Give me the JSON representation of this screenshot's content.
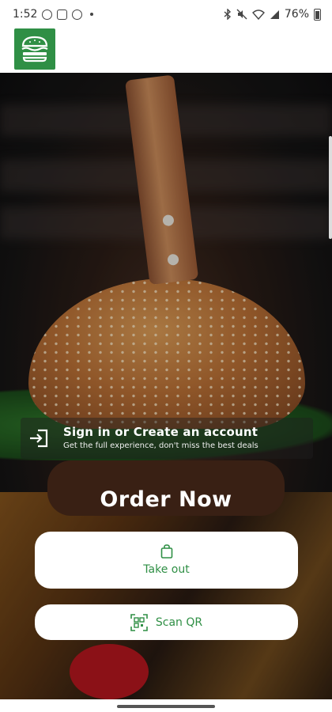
{
  "status_bar": {
    "time": "1:52",
    "battery": "76%"
  },
  "app": {
    "logo_icon": "burger-icon",
    "brand_color": "#2f8f45"
  },
  "signin": {
    "title": "Sign in or Create an account",
    "subtitle": "Get the full experience, don't miss the best deals"
  },
  "order": {
    "title": "Order Now",
    "takeout_label": "Take out",
    "scan_label": "Scan QR"
  }
}
